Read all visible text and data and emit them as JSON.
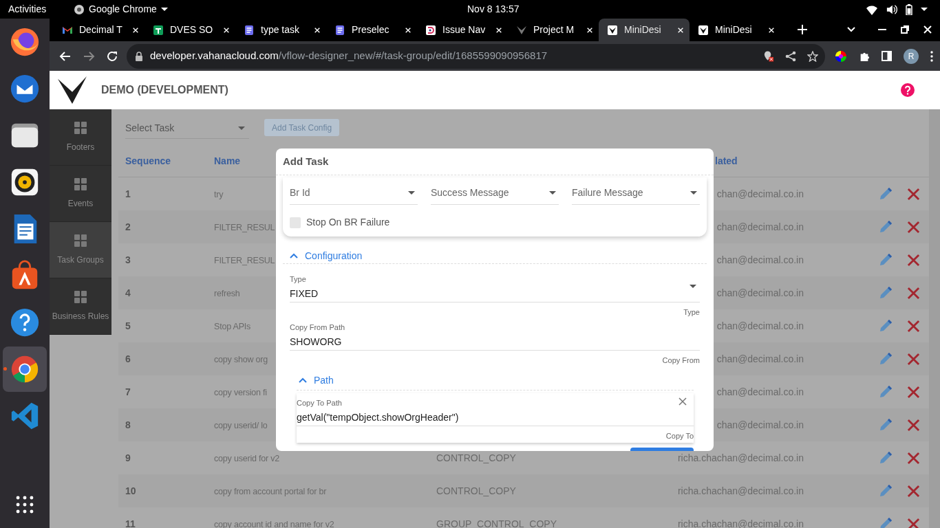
{
  "system_bar": {
    "activities": "Activities",
    "app_menu": "Google Chrome",
    "clock": "Nov 8  13:57"
  },
  "dock": {
    "items": [
      {
        "kind": "firefox",
        "active": false
      },
      {
        "kind": "mail",
        "active": false
      },
      {
        "kind": "files",
        "active": false
      },
      {
        "kind": "music",
        "active": false
      },
      {
        "kind": "writer",
        "active": false
      },
      {
        "kind": "store",
        "active": false
      },
      {
        "kind": "help",
        "active": false
      },
      {
        "kind": "chrome",
        "active": true
      },
      {
        "kind": "code",
        "active": false
      },
      {
        "kind": "grid",
        "active": false
      }
    ]
  },
  "browser": {
    "tabs": [
      {
        "title": "Decimal T",
        "kind": "gmail",
        "selected": false
      },
      {
        "title": "DVES SO",
        "kind": "sheet",
        "selected": false
      },
      {
        "title": "type task",
        "kind": "doc",
        "selected": false
      },
      {
        "title": "Preselec",
        "kind": "doc",
        "selected": false
      },
      {
        "title": "Issue Nav",
        "kind": "issue",
        "selected": false
      },
      {
        "title": "Project M",
        "kind": "vmark",
        "selected": false
      },
      {
        "title": "MiniDesi",
        "kind": "vbox",
        "selected": true
      },
      {
        "title": "MiniDesi",
        "kind": "vbox",
        "selected": false
      }
    ],
    "url": {
      "host": "developer.vahanacloud.com",
      "path": "/vflow-designer_new/#/task-group/edit/1685599090956817"
    },
    "profile_initial": "R"
  },
  "app": {
    "title": "DEMO (DEVELOPMENT)"
  },
  "sidebar": {
    "items": [
      {
        "label": "Footers",
        "selected": false
      },
      {
        "label": "Events",
        "selected": false
      },
      {
        "label": "Task Groups",
        "selected": true
      },
      {
        "label": "Business Rules",
        "selected": false
      }
    ]
  },
  "toolbar": {
    "task_select": {
      "placeholder": "Select Task"
    },
    "add_button": {
      "label": "Add Task Config",
      "disabled": true
    }
  },
  "table": {
    "columns": [
      "Sequence",
      "Name",
      "lated"
    ],
    "rows": [
      {
        "sequence": "1",
        "name": "try",
        "email": "chan@decimal.co.in"
      },
      {
        "sequence": "2",
        "name": "FILTER_RESUL",
        "email": "chan@decimal.co.in"
      },
      {
        "sequence": "3",
        "name": "FILTER_RESUL",
        "email": "chan@decimal.co.in"
      },
      {
        "sequence": "4",
        "name": "refresh",
        "email": "chan@decimal.co.in"
      },
      {
        "sequence": "5",
        "name": "Stop APIs",
        "email": "chan@decimal.co.in"
      },
      {
        "sequence": "6",
        "name": "copy show org",
        "email": "chan@decimal.co.in"
      },
      {
        "sequence": "7",
        "name": "copy version fi",
        "email": "chan@decimal.co.in"
      },
      {
        "sequence": "8",
        "name": "copy userid/ lo",
        "email": "chan@decimal.co.in"
      },
      {
        "sequence": "9",
        "name": "copy userid for v2",
        "type": "CONTROL_COPY",
        "email": "richa.chachan@decimal.co.in"
      },
      {
        "sequence": "10",
        "name": "copy from account portal for br",
        "type": "CONTROL_COPY",
        "email": "richa.chachan@decimal.co.in"
      },
      {
        "sequence": "11",
        "name": "copy account id and name for v2",
        "type": "GROUP_CONTROL_COPY",
        "email": "richa.chachan@decimal.co.in"
      }
    ]
  },
  "dialog": {
    "title": "Add Task",
    "selects": [
      {
        "placeholder": "Br Id"
      },
      {
        "placeholder": "Success Message"
      },
      {
        "placeholder": "Failure Message"
      }
    ],
    "stop_on_failure": {
      "label": "Stop On BR Failure",
      "checked": false
    },
    "configuration": {
      "title": "Configuration",
      "expanded": true,
      "type_field": {
        "label": "Type",
        "value": "FIXED",
        "hint": "Type"
      },
      "copy_from_field": {
        "label": "Copy From Path",
        "value": "SHOWORG",
        "hint": "Copy From"
      },
      "path": {
        "title": "Path",
        "expanded": true,
        "copy_to_field": {
          "label": "Copy To Path",
          "value": "getVal(\"tempObject.showOrgHeader\")",
          "hint": "Copy To"
        }
      }
    }
  }
}
